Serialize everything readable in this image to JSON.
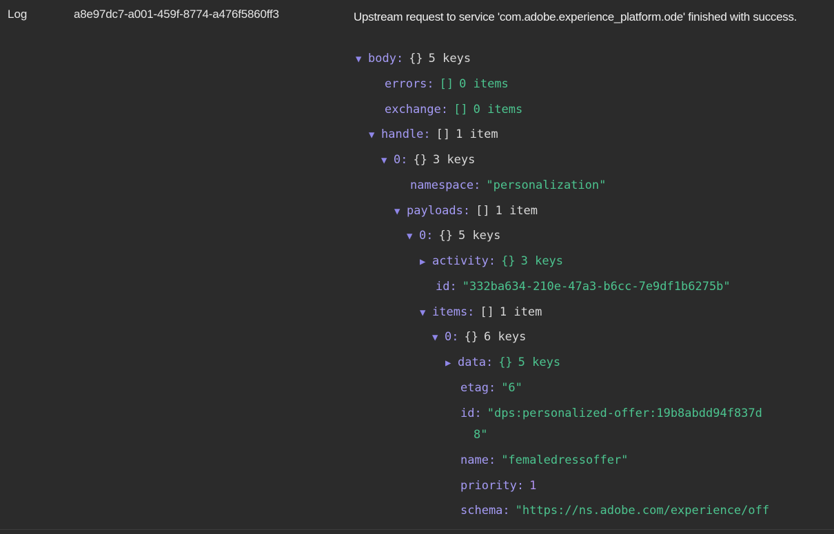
{
  "row": {
    "type": "Log",
    "request_id": "a8e97dc7-a001-459f-8774-a476f5860ff3",
    "message": "Upstream request to service 'com.adobe.experience_platform.ode' finished with success."
  },
  "tree": {
    "body": {
      "key": "body:",
      "type": "{}",
      "count": "5 keys"
    },
    "errors": {
      "key": "errors:",
      "type": "[]",
      "count": "0 items"
    },
    "exchange": {
      "key": "exchange:",
      "type": "[]",
      "count": "0 items"
    },
    "handle": {
      "key": "handle:",
      "type": "[]",
      "count": "1 item"
    },
    "handle0": {
      "key": "0:",
      "type": "{}",
      "count": "3 keys"
    },
    "namespace": {
      "key": "namespace:",
      "value": "\"personalization\""
    },
    "payloads": {
      "key": "payloads:",
      "type": "[]",
      "count": "1 item"
    },
    "payloads0": {
      "key": "0:",
      "type": "{}",
      "count": "5 keys"
    },
    "activity": {
      "key": "activity:",
      "type": "{}",
      "count": "3 keys"
    },
    "payload_id": {
      "key": "id:",
      "value": "\"332ba634-210e-47a3-b6cc-7e9df1b6275b\""
    },
    "items": {
      "key": "items:",
      "type": "[]",
      "count": "1 item"
    },
    "items0": {
      "key": "0:",
      "type": "{}",
      "count": "6 keys"
    },
    "data": {
      "key": "data:",
      "type": "{}",
      "count": "5 keys"
    },
    "etag": {
      "key": "etag:",
      "value": "\"6\""
    },
    "item_id": {
      "key": "id:",
      "value_line1": "\"dps:personalized-offer:19b8abdd94f837d",
      "value_line2": "8\""
    },
    "name": {
      "key": "name:",
      "value": "\"femaledressoffer\""
    },
    "priority": {
      "key": "priority:",
      "value": "1"
    },
    "schema": {
      "key": "schema:",
      "value": "\"https://ns.adobe.com/experience/off"
    }
  },
  "icons": {
    "expanded": "triangle-down-icon",
    "collapsed": "triangle-right-icon"
  },
  "colors": {
    "background": "#2b2b2b",
    "key": "#a59bf5",
    "string": "#4cc48f",
    "number": "#b191f0",
    "arrow": "#8f86e8"
  }
}
